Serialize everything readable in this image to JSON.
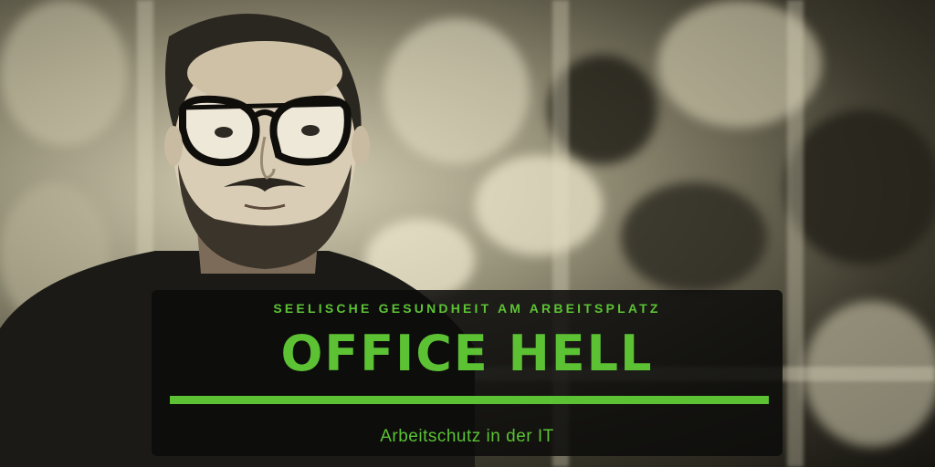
{
  "banner": {
    "subtitle": "SEELISCHE GESUNDHEIT AM ARBEITSPLATZ",
    "title": "OFFICE HELL",
    "tagline": "Arbeitschutz in der IT",
    "accent_color": "#5cc234"
  },
  "image": {
    "subject": "portrait-photo",
    "icon": "person-with-glasses"
  }
}
